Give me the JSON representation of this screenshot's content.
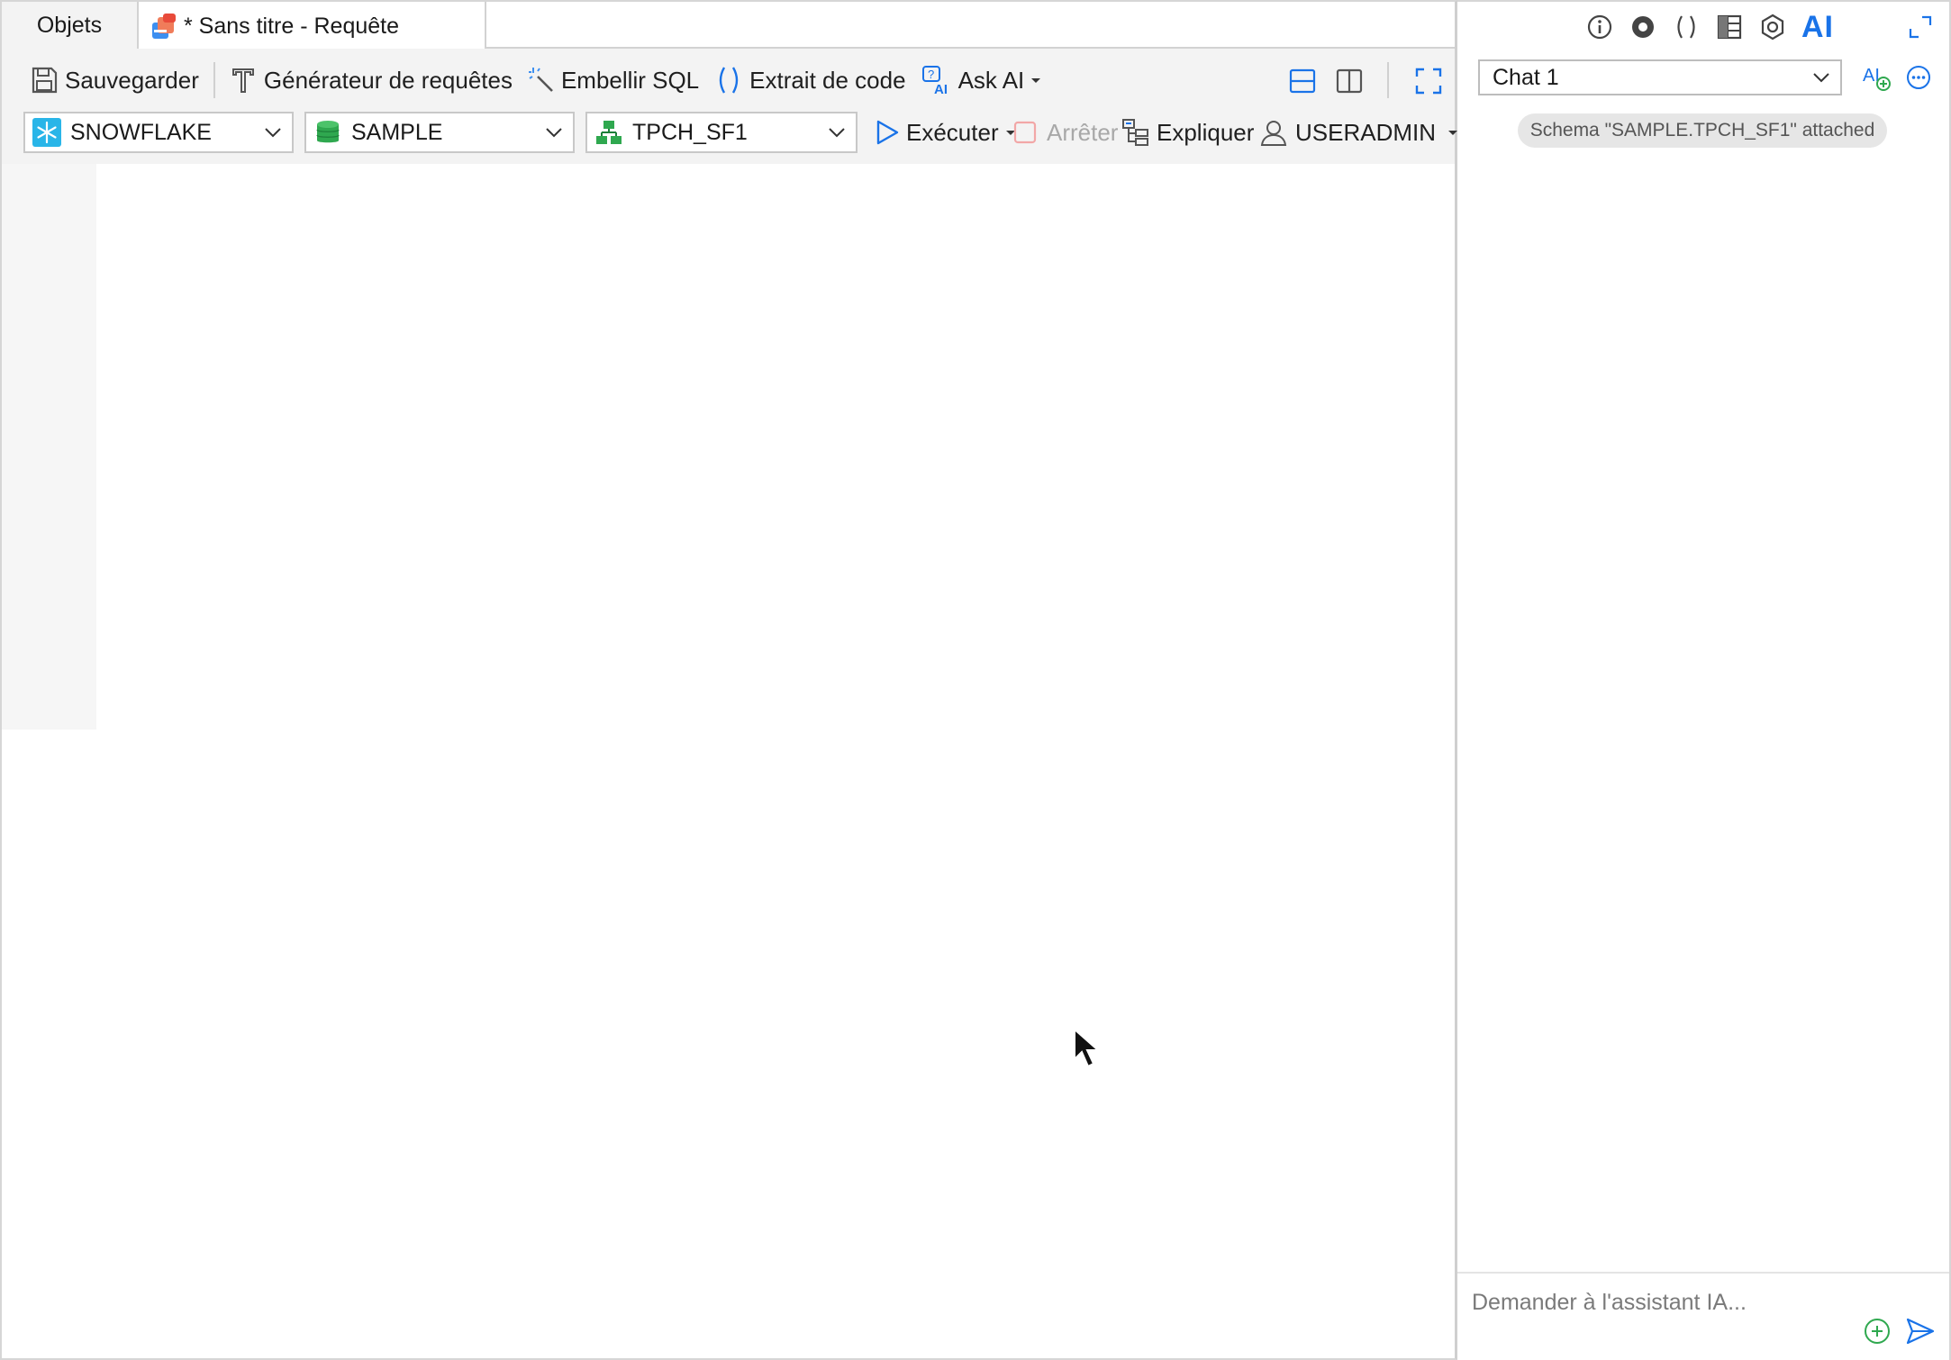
{
  "tabs": {
    "objects_label": "Objets",
    "query_label": "* Sans titre - Requête"
  },
  "toolbar": {
    "save_label": "Sauvegarder",
    "query_builder_label": "Générateur de requêtes",
    "beautify_label": "Embellir SQL",
    "code_snippet_label": "Extrait de code",
    "ask_ai_label": "Ask AI",
    "run_label": "Exécuter",
    "stop_label": "Arrêter",
    "explain_label": "Expliquer",
    "role_label": "USERADMIN"
  },
  "selectors": {
    "connection": "SNOWFLAKE",
    "database": "SAMPLE",
    "schema": "TPCH_SF1"
  },
  "assistant": {
    "ai_tab_label": "AI",
    "chat_select_value": "Chat 1",
    "schema_notice": "Schema \"SAMPLE.TPCH_SF1\" attached",
    "input_placeholder": "Demander à l'assistant IA..."
  },
  "colors": {
    "accent": "#1a73e8",
    "toolbar_bg": "#f3f3f3",
    "green": "#2fa84f",
    "snowflake": "#29b5e8"
  },
  "icons": {
    "info": "info-icon",
    "preview": "eye-icon",
    "snippets": "parentheses-icon",
    "table": "table-icon",
    "hexagon": "hexagon-icon",
    "expand": "expand-icon"
  }
}
